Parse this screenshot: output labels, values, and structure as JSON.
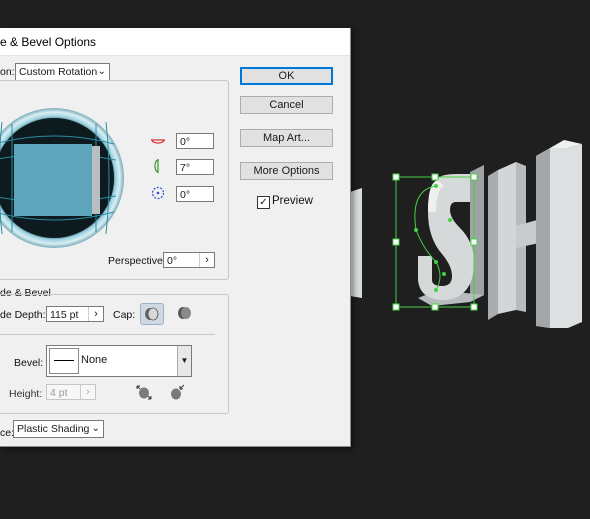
{
  "dialog": {
    "title": "e & Bevel Options",
    "position": {
      "label": "on:",
      "value": "Custom Rotation"
    },
    "rotation": {
      "x": "0°",
      "y": "7°",
      "z": "0°"
    },
    "perspective": {
      "label": "Perspective:",
      "value": "0°"
    },
    "extrude_group": {
      "label": "de & Bevel"
    },
    "extrude_depth": {
      "label": "de Depth:",
      "value": "115 pt"
    },
    "cap": {
      "label": "Cap:"
    },
    "bevel": {
      "label": "Bevel:",
      "value": "None"
    },
    "height": {
      "label": "Height:",
      "value": "4 pt"
    },
    "surface": {
      "label": "ce:",
      "value": "Plastic Shading"
    },
    "buttons": {
      "ok": "OK",
      "cancel": "Cancel",
      "map_art": "Map Art...",
      "more_options": "More Options"
    },
    "preview": {
      "label": "Preview",
      "checked": true
    }
  },
  "artwork": {
    "letters": [
      "S",
      "H"
    ]
  },
  "colors": {
    "canvas_bg": "#1f1f1f",
    "selection": "#44d144",
    "cube_face": "#5fa4bd",
    "accent": "#0078d7"
  }
}
